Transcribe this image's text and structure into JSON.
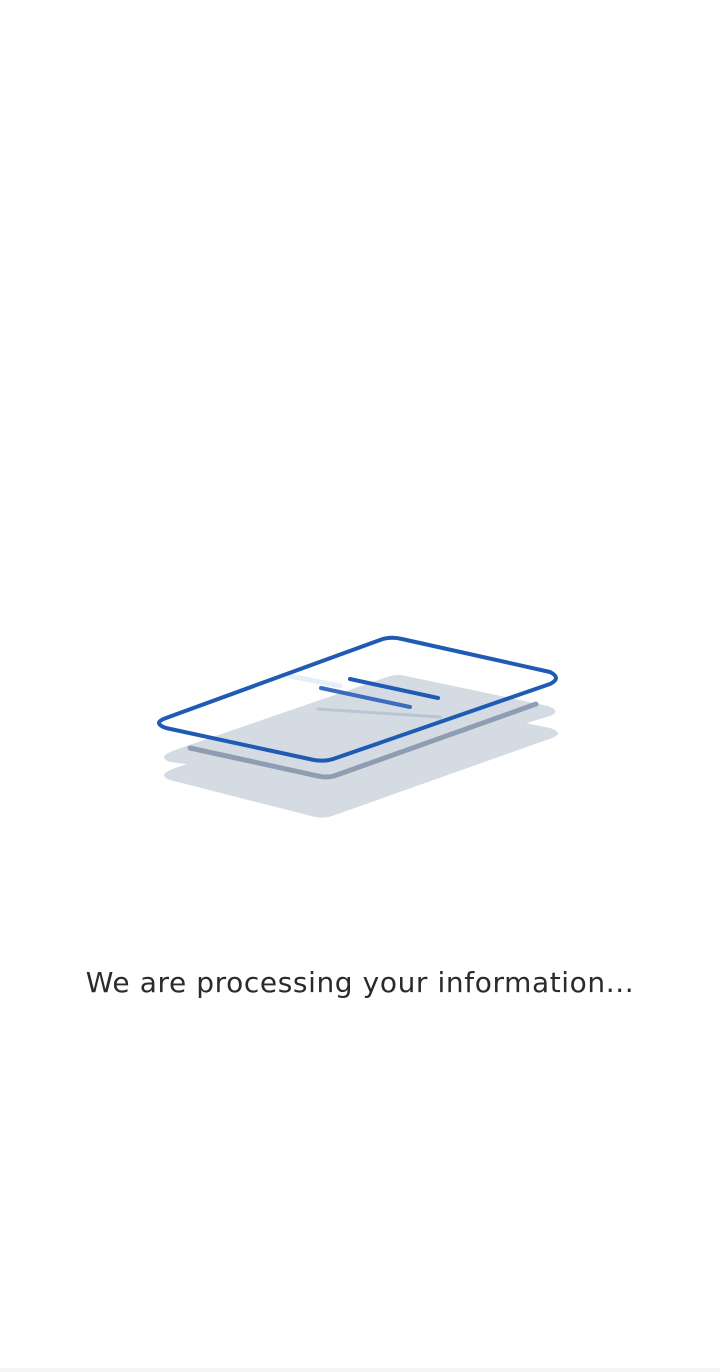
{
  "loading": {
    "message": "We are processing your information...",
    "illustration_icon": "stacked-cards-icon"
  },
  "colors": {
    "background": "#ffffff",
    "text": "#2b2b2b",
    "accent": "#1f5bb5",
    "shadow_light": "#d4dbe3",
    "shadow_dark": "#8f9db3"
  }
}
